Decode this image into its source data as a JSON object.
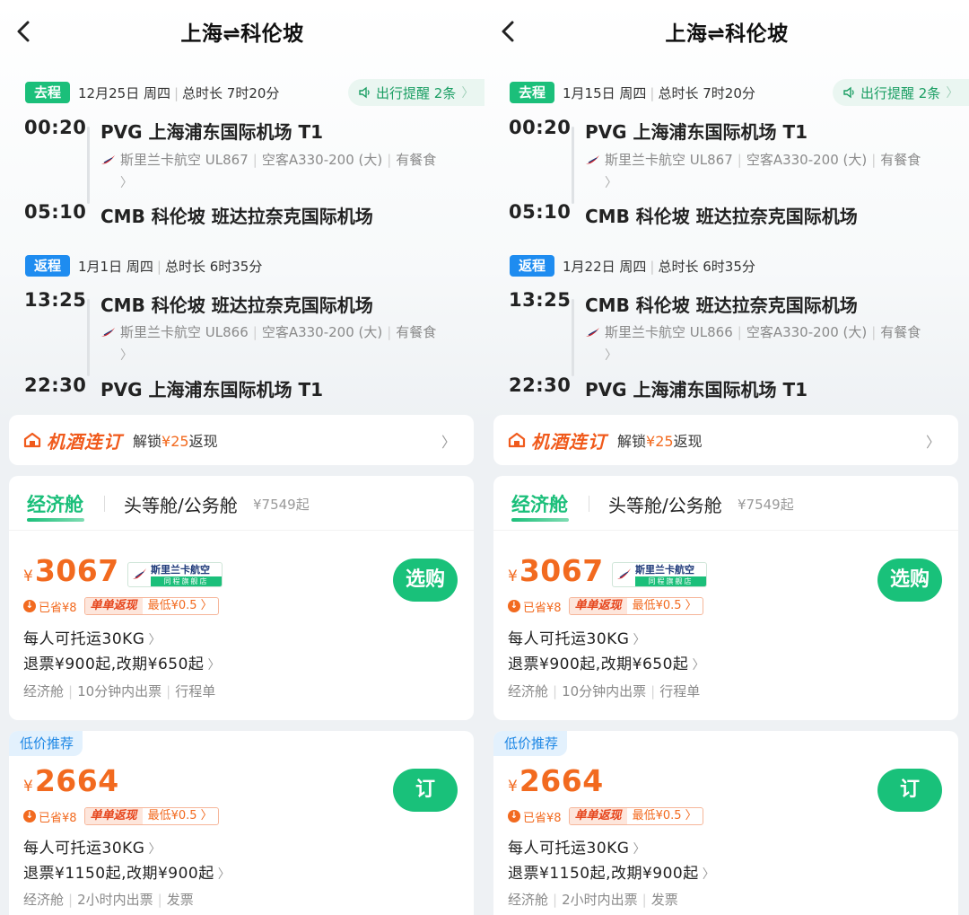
{
  "panels": [
    {
      "title": "上海⇌科伦坡",
      "reminder": "出行提醒 2条",
      "outbound": {
        "tag": "去程",
        "date": "12月25日 周四",
        "duration": "总时长 7时20分",
        "dep_time": "00:20",
        "dep_airport": "PVG 上海浦东国际机场 T1",
        "airline": "斯里兰卡航空 UL867",
        "aircraft": "空客A330-200 (大)",
        "meal": "有餐食",
        "arr_time": "05:10",
        "arr_airport": "CMB 科伦坡 班达拉奈克国际机场"
      },
      "return": {
        "tag": "返程",
        "date": "1月1日 周四",
        "duration": "总时长 6时35分",
        "dep_time": "13:25",
        "dep_airport": "CMB 科伦坡 班达拉奈克国际机场",
        "airline": "斯里兰卡航空 UL866",
        "aircraft": "空客A330-200 (大)",
        "meal": "有餐食",
        "arr_time": "22:30",
        "arr_airport": "PVG 上海浦东国际机场 T1"
      },
      "combo": {
        "brand": "机酒连订",
        "text_pre": "解锁",
        "amount": "¥25",
        "text_post": "返现"
      },
      "tabs": {
        "economy": "经济舱",
        "first": "头等舱/公务舱",
        "first_price": "¥7549起"
      },
      "offers": [
        {
          "currency": "¥",
          "price": "3067",
          "store_name": "斯里兰卡航空",
          "store_sub": "同程旗舰店",
          "saved": "已省¥8",
          "cashback": "单单返现",
          "cashback_min": "最低¥0.5",
          "baggage": "每人可托运30KG",
          "refund": "退票¥900起,改期¥650起",
          "info": [
            "经济舱",
            "10分钟内出票",
            "行程单"
          ],
          "button": "选购"
        },
        {
          "low_tag": "低价推荐",
          "currency": "¥",
          "price": "2664",
          "saved": "已省¥8",
          "cashback": "单单返现",
          "cashback_min": "最低¥0.5",
          "baggage": "每人可托运30KG",
          "refund": "退票¥1150起,改期¥900起",
          "info": [
            "经济舱",
            "2小时内出票",
            "发票"
          ],
          "button": "订"
        }
      ]
    },
    {
      "title": "上海⇌科伦坡",
      "reminder": "出行提醒 2条",
      "outbound": {
        "tag": "去程",
        "date": "1月15日 周四",
        "duration": "总时长 7时20分",
        "dep_time": "00:20",
        "dep_airport": "PVG 上海浦东国际机场 T1",
        "airline": "斯里兰卡航空 UL867",
        "aircraft": "空客A330-200 (大)",
        "meal": "有餐食",
        "arr_time": "05:10",
        "arr_airport": "CMB 科伦坡 班达拉奈克国际机场"
      },
      "return": {
        "tag": "返程",
        "date": "1月22日 周四",
        "duration": "总时长 6时35分",
        "dep_time": "13:25",
        "dep_airport": "CMB 科伦坡 班达拉奈克国际机场",
        "airline": "斯里兰卡航空 UL866",
        "aircraft": "空客A330-200 (大)",
        "meal": "有餐食",
        "arr_time": "22:30",
        "arr_airport": "PVG 上海浦东国际机场 T1"
      },
      "combo": {
        "brand": "机酒连订",
        "text_pre": "解锁",
        "amount": "¥25",
        "text_post": "返现"
      },
      "tabs": {
        "economy": "经济舱",
        "first": "头等舱/公务舱",
        "first_price": "¥7549起"
      },
      "offers": [
        {
          "currency": "¥",
          "price": "3067",
          "store_name": "斯里兰卡航空",
          "store_sub": "同程旗舰店",
          "saved": "已省¥8",
          "cashback": "单单返现",
          "cashback_min": "最低¥0.5",
          "baggage": "每人可托运30KG",
          "refund": "退票¥900起,改期¥650起",
          "info": [
            "经济舱",
            "10分钟内出票",
            "行程单"
          ],
          "button": "选购"
        },
        {
          "low_tag": "低价推荐",
          "currency": "¥",
          "price": "2664",
          "saved": "已省¥8",
          "cashback": "单单返现",
          "cashback_min": "最低¥0.5",
          "baggage": "每人可托运30KG",
          "refund": "退票¥1150起,改期¥900起",
          "info": [
            "经济舱",
            "2小时内出票",
            "发票"
          ],
          "button": "订"
        }
      ]
    }
  ]
}
